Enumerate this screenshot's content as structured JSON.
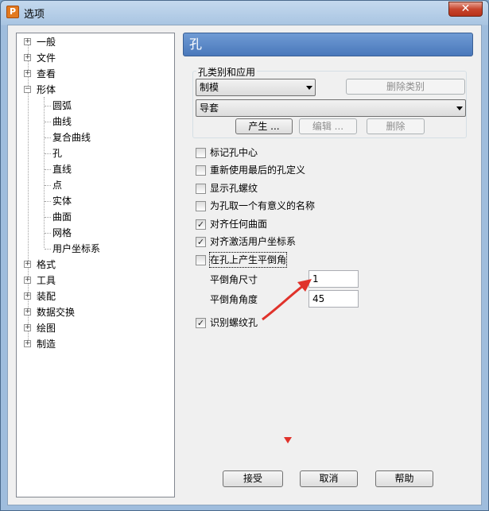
{
  "window": {
    "title": "选项",
    "app_icon_letter": "P",
    "close_glyph": "✕"
  },
  "tree": {
    "top_items": [
      {
        "label": "一般",
        "expander": "+"
      },
      {
        "label": "文件",
        "expander": "+"
      },
      {
        "label": "查看",
        "expander": "+"
      },
      {
        "label": "形体",
        "expander": "−"
      }
    ],
    "children": [
      "圆弧",
      "曲线",
      "复合曲线",
      "孔",
      "直线",
      "点",
      "实体",
      "曲面",
      "网格",
      "用户坐标系"
    ],
    "bottom_items": [
      {
        "label": "格式",
        "expander": "+"
      },
      {
        "label": "工具",
        "expander": "+"
      },
      {
        "label": "装配",
        "expander": "+"
      },
      {
        "label": "数据交换",
        "expander": "+"
      },
      {
        "label": "绘图",
        "expander": "+"
      },
      {
        "label": "制造",
        "expander": "+"
      }
    ]
  },
  "panel": {
    "title": "孔",
    "group_label": "孔类别和应用",
    "category_select": "制模",
    "delete_category_button": "删除类别",
    "application_select": "导套",
    "generate_button": "产生 ...",
    "edit_button": "编辑 ...",
    "delete_button": "删除",
    "checkboxes": [
      {
        "label": "标记孔中心",
        "checked": false
      },
      {
        "label": "重新使用最后的孔定义",
        "checked": false
      },
      {
        "label": "显示孔螺纹",
        "checked": false
      },
      {
        "label": "为孔取一个有意义的名称",
        "checked": false
      },
      {
        "label": "对齐任何曲面",
        "checked": true
      },
      {
        "label": "对齐激活用户坐标系",
        "checked": true
      },
      {
        "label": "在孔上产生平倒角",
        "checked": false
      }
    ],
    "chamfer_size_label": "平倒角尺寸",
    "chamfer_size_value": "1",
    "chamfer_angle_label": "平倒角角度",
    "chamfer_angle_value": "45",
    "thread_hole": {
      "label": "识别螺纹孔",
      "checked": true
    }
  },
  "footer": {
    "accept": "接受",
    "cancel": "取消",
    "help": "帮助"
  },
  "colors": {
    "title_blue": "#4a78bb",
    "annotation_red": "#e0322b"
  },
  "check_glyph": "✓"
}
